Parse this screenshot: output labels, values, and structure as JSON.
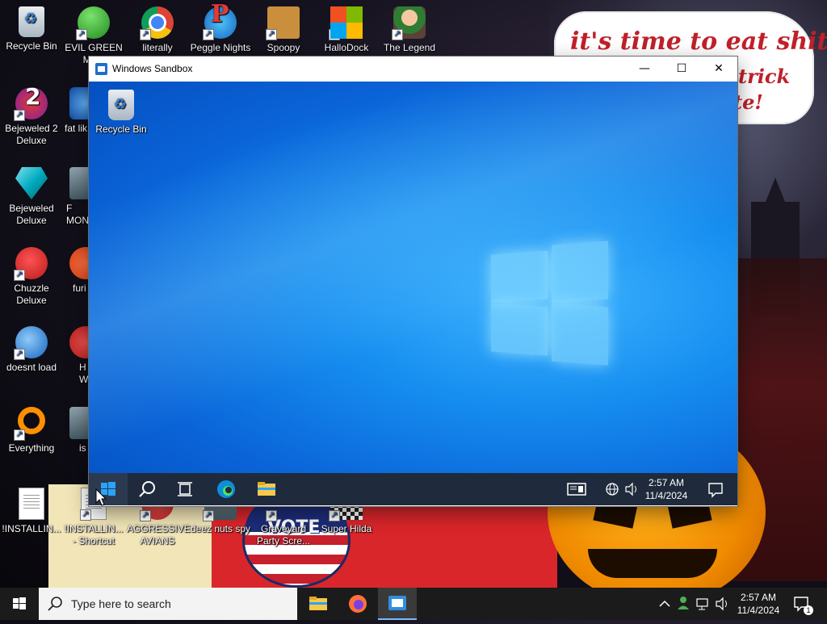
{
  "speech_bubble": {
    "line1": "it's time to eat shit",
    "line2": "trick",
    "line3": "te!"
  },
  "desktop_icons": [
    {
      "label": "Recycle Bin"
    },
    {
      "label": "EVIL GREEN MEN"
    },
    {
      "label": "literally"
    },
    {
      "label": "Peggle Nights"
    },
    {
      "label": "Spoopy"
    },
    {
      "label": "HalloDock"
    },
    {
      "label": "The Legend"
    },
    {
      "label": "Bejeweled 2 Deluxe"
    },
    {
      "label": "fat lik"
    },
    {
      "label": "Bejeweled Deluxe"
    },
    {
      "label": "F MON"
    },
    {
      "label": "Chuzzle Deluxe"
    },
    {
      "label": "furi"
    },
    {
      "label": "doesnt load"
    },
    {
      "label": "H W"
    },
    {
      "label": "Everything"
    },
    {
      "label": "is"
    },
    {
      "label": "!INSTALLIN..."
    },
    {
      "label": "!INSTALLIN... - Shortcut"
    },
    {
      "label": "AGGRESSIVE AVIANS"
    },
    {
      "label": "deez nuts spy"
    },
    {
      "label": "Graveyard Party Scre..."
    },
    {
      "label": "Super Hilda"
    }
  ],
  "vote_text": "VOTE",
  "window": {
    "title": "Windows Sandbox",
    "minimize": "—",
    "maximize": "☐",
    "close": "✕"
  },
  "sandbox": {
    "recycle_bin": "Recycle Bin",
    "time": "2:57 AM",
    "date": "11/4/2024"
  },
  "taskbar": {
    "search_placeholder": "Type here to search",
    "time": "2:57 AM",
    "date": "11/4/2024",
    "notification_count": "1"
  },
  "colors": {
    "sandbox_taskbar": "#1f2b3c",
    "taskbar": "#1b1b1b",
    "sandbox_wallpaper": "#0a64d8",
    "speech_text": "#c0202a"
  }
}
